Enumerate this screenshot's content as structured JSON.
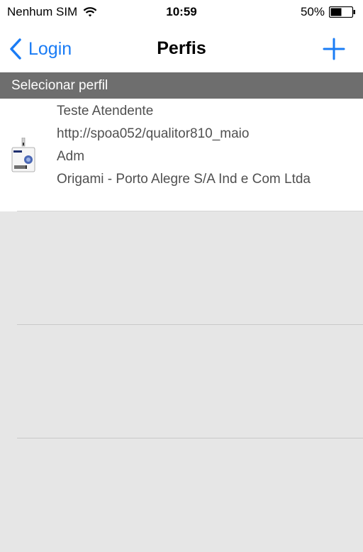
{
  "status_bar": {
    "carrier": "Nenhum SIM",
    "time": "10:59",
    "battery": "50%"
  },
  "nav": {
    "back_label": "Login",
    "title": "Perfis"
  },
  "section": {
    "header": "Selecionar perfil"
  },
  "profiles": [
    {
      "name": "Teste Atendente",
      "url": "http://spoa052/qualitor810_maio",
      "role": "Adm",
      "company": "Origami - Porto Alegre S/A Ind e Com Ltda"
    }
  ],
  "colors": {
    "accent": "#1a7cf5",
    "header_bg": "#6e6e6e",
    "page_bg": "#e6e6e6"
  },
  "icons": {
    "back": "chevron-left-icon",
    "add": "plus-icon",
    "wifi": "wifi-icon",
    "battery": "battery-icon",
    "profile": "id-badge-icon"
  }
}
